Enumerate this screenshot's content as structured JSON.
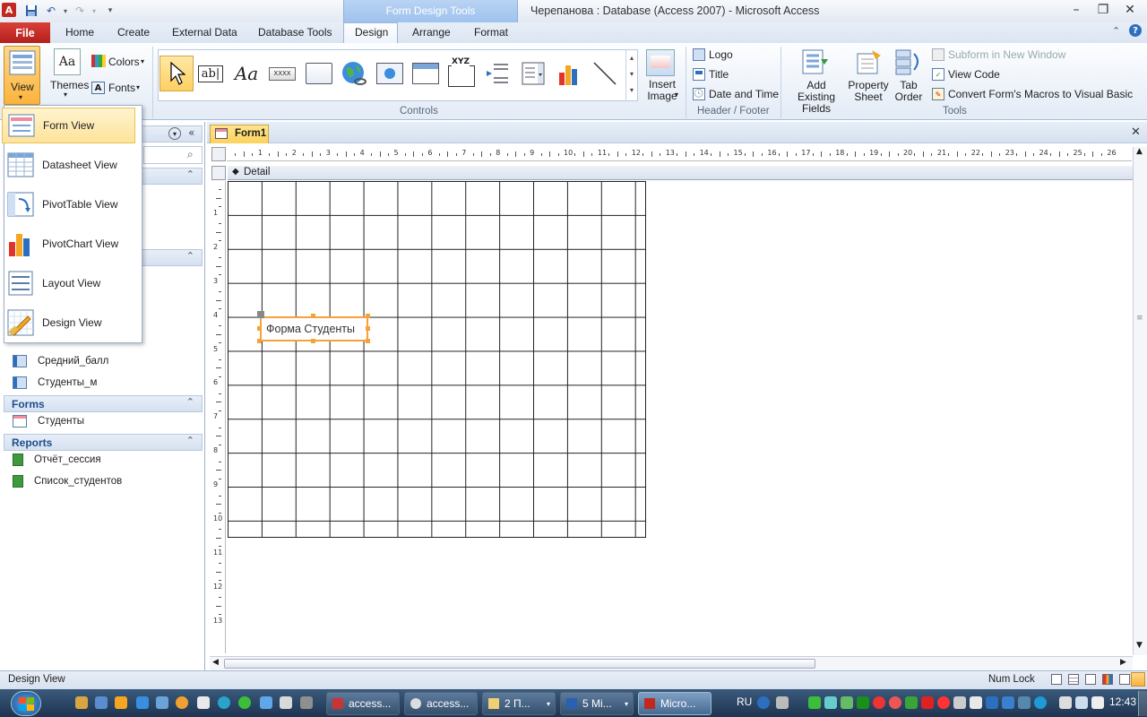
{
  "title": {
    "context_tab": "Form Design Tools",
    "window": "Черепанова : Database (Access 2007)  -  Microsoft Access"
  },
  "tabs": {
    "file": "File",
    "items": [
      "Home",
      "Create",
      "External Data",
      "Database Tools",
      "Design",
      "Arrange",
      "Format"
    ]
  },
  "ribbon": {
    "view": "View",
    "themes": "Themes",
    "colors": "Colors",
    "fonts": "Fonts",
    "insert_image": "Insert Image",
    "logo": "Logo",
    "title_btn": "Title",
    "date_time": "Date and Time",
    "add_fields_1": "Add Existing",
    "add_fields_2": "Fields",
    "prop_1": "Property",
    "prop_2": "Sheet",
    "tab_1": "Tab",
    "tab_2": "Order",
    "subform": "Subform in New Window",
    "view_code": "View Code",
    "convert": "Convert Form's Macros to Visual Basic",
    "groups": {
      "controls": "Controls",
      "header_footer": "Header / Footer",
      "tools": "Tools"
    },
    "ctrl_xyz": "XYZ"
  },
  "view_menu": {
    "items": [
      "Form View",
      "Datasheet View",
      "PivotTable View",
      "PivotChart View",
      "Layout View",
      "Design View"
    ]
  },
  "nav": {
    "queries": [
      "Средний_балл",
      "Студенты_м"
    ],
    "forms_header": "Forms",
    "forms": [
      "Студенты"
    ],
    "reports_header": "Reports",
    "reports": [
      "Отчёт_сессия",
      "Список_студентов"
    ]
  },
  "document": {
    "tab": "Form1",
    "section": "Detail",
    "label": "Форма Студенты",
    "ruler_h": [
      "1",
      "2",
      "3",
      "4",
      "5",
      "6",
      "7",
      "8",
      "9",
      "10",
      "11",
      "12",
      "13",
      "14",
      "15",
      "16",
      "17",
      "18",
      "19",
      "20",
      "21",
      "22",
      "23",
      "24",
      "25",
      "26"
    ],
    "ruler_v": [
      "1",
      "2",
      "3",
      "4",
      "5",
      "6",
      "7",
      "8",
      "9",
      "10",
      "11",
      "12",
      "13"
    ]
  },
  "status": {
    "left": "Design View",
    "num_lock": "Num Lock"
  },
  "taskbar": {
    "buttons": [
      "access...",
      "access...",
      "2 П...",
      "5 Mi...",
      "Micro..."
    ],
    "lang": "RU",
    "time": "12:43"
  },
  "colors": {
    "accent": "#fdd25e",
    "file_tab": "#c1281f",
    "selection": "#f6a23a"
  }
}
